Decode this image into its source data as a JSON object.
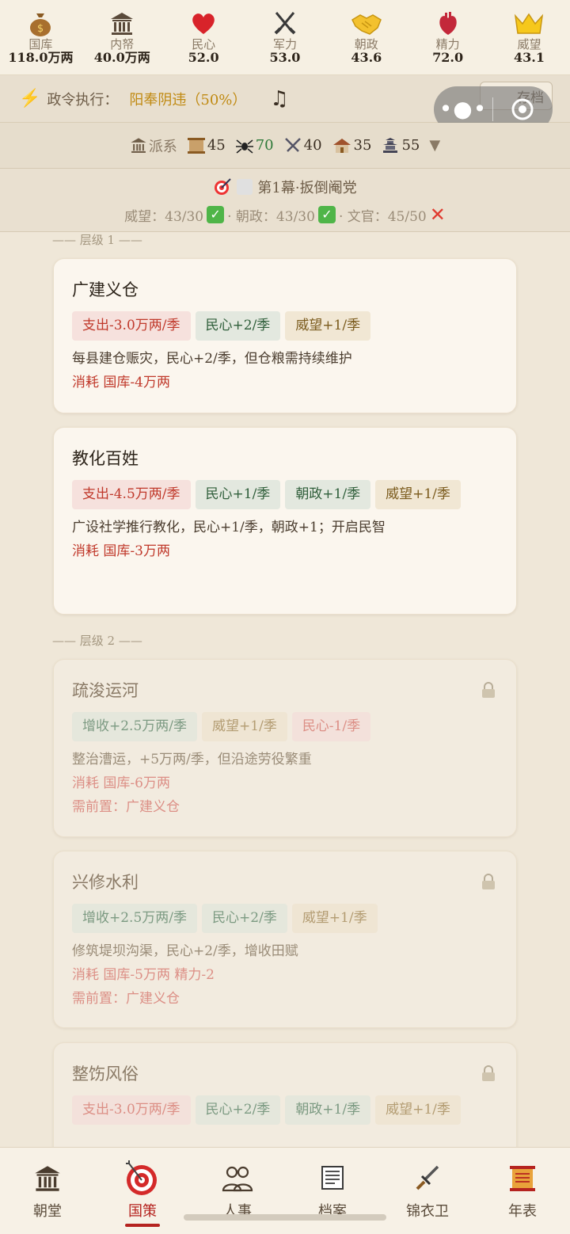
{
  "stats": [
    {
      "label": "国库",
      "value": "118.0万两",
      "icon": "money-bag-icon"
    },
    {
      "label": "内帑",
      "value": "40.0万两",
      "icon": "temple-icon"
    },
    {
      "label": "民心",
      "value": "52.0",
      "icon": "heart-icon"
    },
    {
      "label": "军力",
      "value": "53.0",
      "icon": "crossed-swords-icon"
    },
    {
      "label": "朝政",
      "value": "43.6",
      "icon": "handshake-icon"
    },
    {
      "label": "精力",
      "value": "72.0",
      "icon": "anatomical-heart-icon"
    },
    {
      "label": "威望",
      "value": "43.1",
      "icon": "crown-icon"
    }
  ],
  "exec": {
    "label": "政令执行：",
    "value": "阳奉阴违（50%）",
    "save_label": "存档"
  },
  "factions": {
    "label": "派系",
    "items": [
      {
        "icon": "scroll-icon",
        "value": "45"
      },
      {
        "icon": "spider-icon",
        "value": "70"
      },
      {
        "icon": "crossed-swords-icon",
        "value": "40"
      },
      {
        "icon": "house-icon",
        "value": "35"
      },
      {
        "icon": "pagoda-icon",
        "value": "55"
      }
    ],
    "expand": "▼"
  },
  "act": {
    "title": "第1幕·扳倒阉党",
    "conditions": [
      {
        "text": "威望：43/30",
        "met": true
      },
      {
        "text": "· 朝政：43/30",
        "met": true
      },
      {
        "text": "· 文官：45/50",
        "met": false
      }
    ]
  },
  "tiers": [
    "—— 层级 1 ——",
    "—— 层级 2 ——"
  ],
  "policies": [
    {
      "name": "广建义仓",
      "locked": false,
      "tags": [
        {
          "text": "支出-3.0万两/季",
          "kind": "red"
        },
        {
          "text": "民心+2/季",
          "kind": "green"
        },
        {
          "text": "威望+1/季",
          "kind": "gold"
        }
      ],
      "desc": "每县建仓赈灾，民心+2/季，但仓粮需持续维护",
      "cost": "消耗 国库-4万两",
      "prereq": ""
    },
    {
      "name": "教化百姓",
      "locked": false,
      "tags": [
        {
          "text": "支出-4.5万两/季",
          "kind": "red"
        },
        {
          "text": "民心+1/季",
          "kind": "green"
        },
        {
          "text": "朝政+1/季",
          "kind": "green"
        },
        {
          "text": "威望+1/季",
          "kind": "gold"
        }
      ],
      "desc": "广设社学推行教化，民心+1/季，朝政+1；开启民智",
      "cost": "消耗 国库-3万两",
      "prereq": ""
    },
    {
      "name": "疏浚运河",
      "locked": true,
      "tags": [
        {
          "text": "增收+2.5万两/季",
          "kind": "green"
        },
        {
          "text": "威望+1/季",
          "kind": "gold"
        },
        {
          "text": "民心-1/季",
          "kind": "red"
        }
      ],
      "desc": "整治漕运，+5万两/季，但沿途劳役繁重",
      "cost": "消耗 国库-6万两",
      "prereq": "需前置：广建义仓"
    },
    {
      "name": "兴修水利",
      "locked": true,
      "tags": [
        {
          "text": "增收+2.5万两/季",
          "kind": "green"
        },
        {
          "text": "民心+2/季",
          "kind": "green"
        },
        {
          "text": "威望+1/季",
          "kind": "gold"
        }
      ],
      "desc": "修筑堤坝沟渠，民心+2/季，增收田赋",
      "cost": "消耗 国库-5万两 精力-2",
      "prereq": "需前置：广建义仓"
    },
    {
      "name": "整饬风俗",
      "locked": true,
      "tags": [
        {
          "text": "支出-3.0万两/季",
          "kind": "red"
        },
        {
          "text": "民心+2/季",
          "kind": "green"
        },
        {
          "text": "朝政+1/季",
          "kind": "green"
        },
        {
          "text": "威望+1/季",
          "kind": "gold"
        }
      ],
      "desc": "",
      "cost": "",
      "prereq": ""
    }
  ],
  "nav": [
    {
      "label": "朝堂",
      "icon": "temple-icon",
      "active": false
    },
    {
      "label": "国策",
      "icon": "target-icon",
      "active": true
    },
    {
      "label": "人事",
      "icon": "people-icon",
      "active": false
    },
    {
      "label": "档案",
      "icon": "document-icon",
      "active": false
    },
    {
      "label": "锦衣卫",
      "icon": "dagger-icon",
      "active": false
    },
    {
      "label": "年表",
      "icon": "scroll-icon",
      "active": false
    }
  ]
}
